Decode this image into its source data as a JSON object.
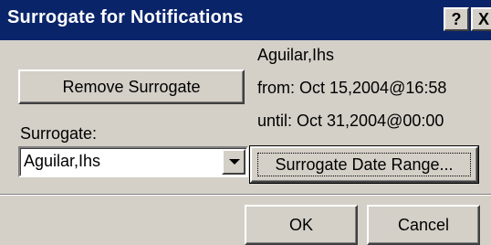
{
  "dialog": {
    "title": "Surrogate for Notifications",
    "help_glyph": "?",
    "close_glyph": "X"
  },
  "surrogate_info": {
    "name": "Aguilar,Ihs",
    "from": "from: Oct 15,2004@16:58",
    "until": "until: Oct 31,2004@00:00"
  },
  "buttons": {
    "remove_label": "Remove Surrogate",
    "date_range_label": "Surrogate Date Range...",
    "ok_label": "OK",
    "cancel_label": "Cancel"
  },
  "surrogate_field": {
    "label": "Surrogate:",
    "selected_value": "Aguilar,Ihs"
  },
  "colors": {
    "titlebar": "#0a246a",
    "window": "#d4d0c8"
  }
}
